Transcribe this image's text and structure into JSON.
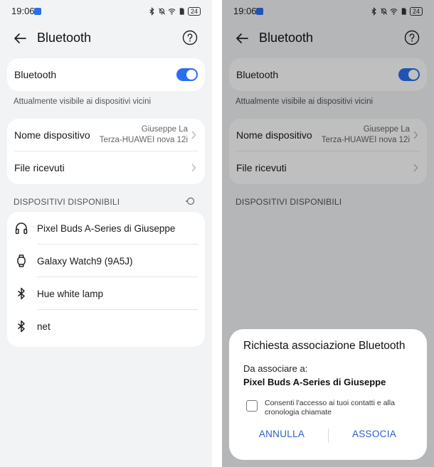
{
  "status": {
    "time": "19:06",
    "battery": "24"
  },
  "header": {
    "title": "Bluetooth"
  },
  "bluetooth_toggle": {
    "label": "Bluetooth",
    "on": true
  },
  "visibility_text": "Attualmente visibile ai dispositivi vicini",
  "device_name": {
    "label": "Nome dispositivo",
    "value_line1": "Giuseppe La",
    "value_line2": "Terza-HUAWEI nova 12i"
  },
  "received_files": {
    "label": "File ricevuti"
  },
  "available_devices": {
    "header": "DISPOSITIVI DISPONIBILI",
    "items": [
      {
        "name": "Pixel Buds A-Series di Giuseppe",
        "icon": "headphones-icon"
      },
      {
        "name": "Galaxy Watch9 (9A5J)",
        "icon": "watch-icon"
      },
      {
        "name": "Hue white lamp",
        "icon": "bluetooth-icon"
      },
      {
        "name": "net",
        "icon": "bluetooth-icon"
      }
    ]
  },
  "pair_dialog": {
    "title": "Richiesta associazione Bluetooth",
    "subtitle": "Da associare a:",
    "device": "Pixel Buds A-Series di Giuseppe",
    "checkbox_label": "Consenti l'accesso ai tuoi contatti e alla cronologia chiamate",
    "cancel": "ANNULLA",
    "confirm": "ASSOCIA"
  },
  "colors": {
    "accent": "#2a6ff0",
    "button_text": "#2a5fc9",
    "background": "#f1f3f5",
    "card": "#ffffff"
  }
}
